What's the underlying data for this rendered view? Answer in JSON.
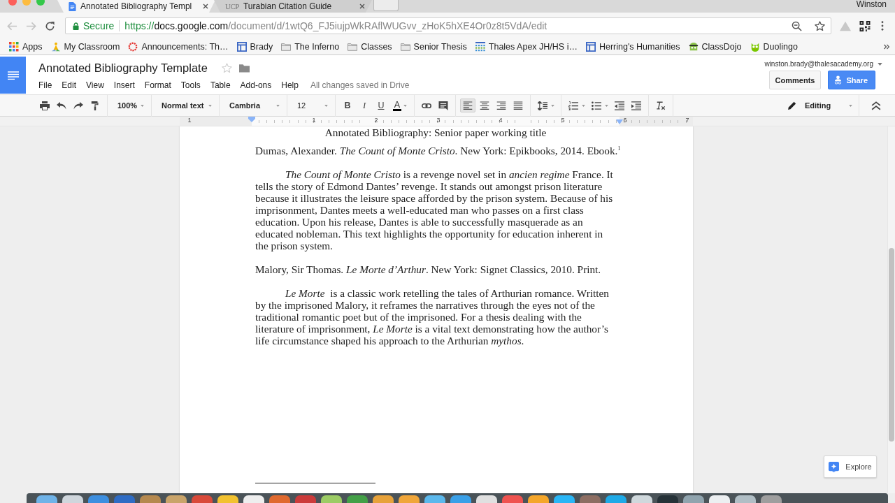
{
  "window": {
    "profile_name": "Winston"
  },
  "tabs": [
    {
      "title": "Annotated Bibliography Templ",
      "selected": true
    },
    {
      "title": "Turabian Citation Guide",
      "favicon_text": "UCP",
      "selected": false
    }
  ],
  "address_bar": {
    "back_disabled": true,
    "forward_disabled": true,
    "security_label": "Secure",
    "url": {
      "scheme": "https://",
      "host": "docs.google.com",
      "path": "/document/d/1wtQ6_FJ5iujpWkRAflWUGvv_zHoK5hXE4Or0z8t5VdA/edit"
    }
  },
  "bookmarks": [
    {
      "label": "Apps",
      "kind": "apps"
    },
    {
      "label": "My Classroom",
      "kind": "classroom"
    },
    {
      "label": "Announcements: Th…",
      "kind": "ring"
    },
    {
      "label": "Brady",
      "kind": "board"
    },
    {
      "label": "The Inferno",
      "kind": "folder"
    },
    {
      "label": "Classes",
      "kind": "folder"
    },
    {
      "label": "Senior Thesis",
      "kind": "folder"
    },
    {
      "label": "Thales Apex JH/HS i…",
      "kind": "grid"
    },
    {
      "label": "Herring's Humanities",
      "kind": "board"
    },
    {
      "label": "ClassDojo",
      "kind": "monster"
    },
    {
      "label": "Duolingo",
      "kind": "owl"
    }
  ],
  "docs": {
    "title": "Annotated Bibliography Template",
    "starred": false,
    "menu": [
      "File",
      "Edit",
      "View",
      "Insert",
      "Format",
      "Tools",
      "Table",
      "Add-ons",
      "Help"
    ],
    "save_status": "All changes saved in Drive",
    "account": "winston.brady@thalesacademy.org",
    "comments_label": "Comments",
    "share_label": "Share"
  },
  "toolbar": {
    "zoom": "100%",
    "style": "Normal text",
    "font": "Cambria",
    "size": "12",
    "format_buttons": [
      {
        "label": "B",
        "kind": "bold"
      },
      {
        "label": "I",
        "kind": "italic"
      },
      {
        "label": "U",
        "kind": "underline"
      },
      {
        "label": "A",
        "kind": "text_color"
      }
    ],
    "alignment": [
      {
        "kind": "left",
        "selected": true
      },
      {
        "kind": "center",
        "selected": false
      },
      {
        "kind": "right",
        "selected": false
      },
      {
        "kind": "justify",
        "selected": false
      }
    ],
    "mode": "Editing"
  },
  "ruler": {
    "labels": [
      "1",
      "1",
      "2",
      "3",
      "4",
      "5",
      "6",
      "7"
    ]
  },
  "document": {
    "heading": "Annotated Bibliography: Senior paper working title",
    "entries": [
      {
        "kind": "citation",
        "text": "Dumas, Alexander. *The Count of Monte Cristo*. New York: Epikbooks, 2014. Ebook.$^{1}$"
      },
      {
        "kind": "annotation",
        "text": "*The Count of Monte Cristo* is a revenge novel set in *ancien regime* France. It tells the story of Edmond Dantes’ revenge. It stands out amongst prison literature because it illustrates the leisure space afforded by the prison system. Because of his imprisonment, Dantes meets a well-educated man who passes on a first class education. Upon his release, Dantes is able to successfully masquerade as an educated nobleman. This text highlights the opportunity for education inherent in the prison system."
      },
      {
        "kind": "citation",
        "text": "Malory, Sir Thomas. *Le Morte d’Arthur*. New York: Signet Classics, 2010. Print."
      },
      {
        "kind": "annotation",
        "text": "*Le Morte*  is a classic work retelling the tales of Arthurian romance. Written by the imprisoned Malory, it reframes the narratives through the eyes not of the traditional romantic poet but of the imprisoned. For a thesis dealing with the literature of imprisonment, *Le Morte* is a vital text demonstrating how the author’s life circumstance shaped his approach to the Arthurian *mythos*."
      }
    ]
  },
  "explore_label": "Explore"
}
